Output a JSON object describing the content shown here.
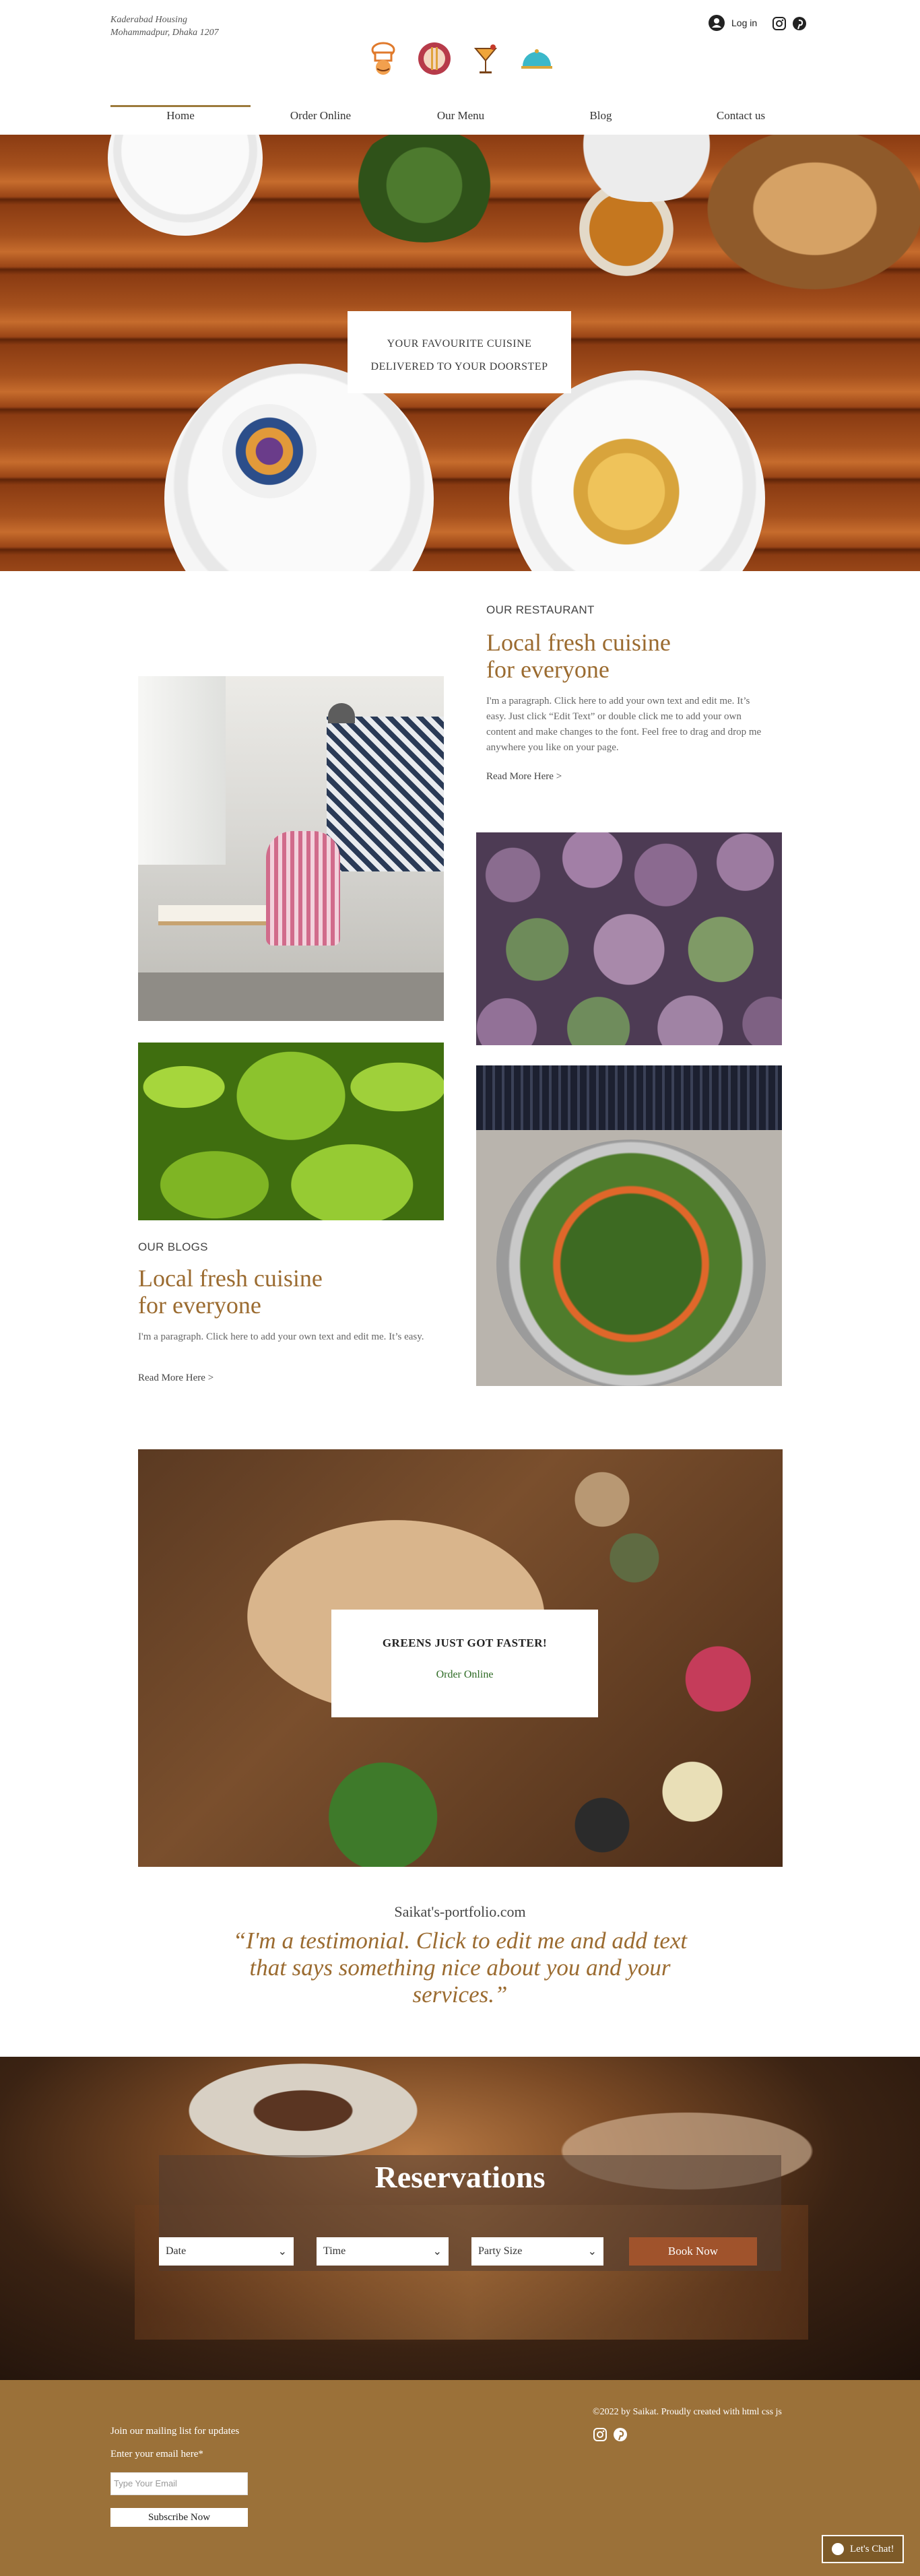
{
  "header": {
    "address_line1": "Kaderabad Housing",
    "address_line2": "Mohammadpur, Dhaka 1207",
    "login_label": "Log in",
    "logos": [
      "chef-icon",
      "knife-fork-icon",
      "cocktail-icon",
      "food-dome-icon"
    ]
  },
  "nav": {
    "items": [
      {
        "label": "Home",
        "active": true
      },
      {
        "label": "Order Online",
        "active": false
      },
      {
        "label": "Our Menu",
        "active": false
      },
      {
        "label": "Blog",
        "active": false
      },
      {
        "label": "Contact us",
        "active": false
      }
    ]
  },
  "hero": {
    "line1": "YOUR FAVOURITE CUISINE",
    "line2": "DELIVERED TO YOUR DOORSTEP"
  },
  "restaurant": {
    "label": "OUR RESTAURANT",
    "title_line1": "Local fresh cuisine",
    "title_line2": "for everyone",
    "paragraph": "I'm a paragraph. Click here to add your own text and edit me. It’s easy. Just click “Edit Text” or double click me to add your own content and make changes to the font. Feel free to drag and drop me anywhere you like on your page.",
    "more": "Read More Here >"
  },
  "blogs": {
    "label": "OUR BLOGS",
    "title_line1": "Local fresh cuisine",
    "title_line2": "for everyone",
    "paragraph": "I'm a paragraph. Click here to add your own text and edit me. It’s easy.",
    "more": "Read More Here >"
  },
  "banner": {
    "title": "GREENS JUST GOT FASTER!",
    "link": "Order Online"
  },
  "testimonial": {
    "name": "Saikat's-portfolio.com",
    "quote": "“I'm a testimonial. Click to edit me and add text that says something nice about you and your services.”"
  },
  "reservations": {
    "title": "Reservations",
    "date_label": "Date",
    "time_label": "Time",
    "party_label": "Party Size",
    "book_label": "Book Now"
  },
  "footer": {
    "mailing": "Join our mailing list for updates",
    "email_label": "Enter your email here*",
    "email_placeholder": "Type Your Email",
    "subscribe": "Subscribe Now",
    "copyright": "©2022 by Saikat. Proudly created with html css js",
    "chat": "Let's Chat!"
  },
  "colors": {
    "accent": "#9b6b30",
    "footer_bg": "#9b7139",
    "book_btn": "#a0532c",
    "order_link": "#2e6b25"
  }
}
